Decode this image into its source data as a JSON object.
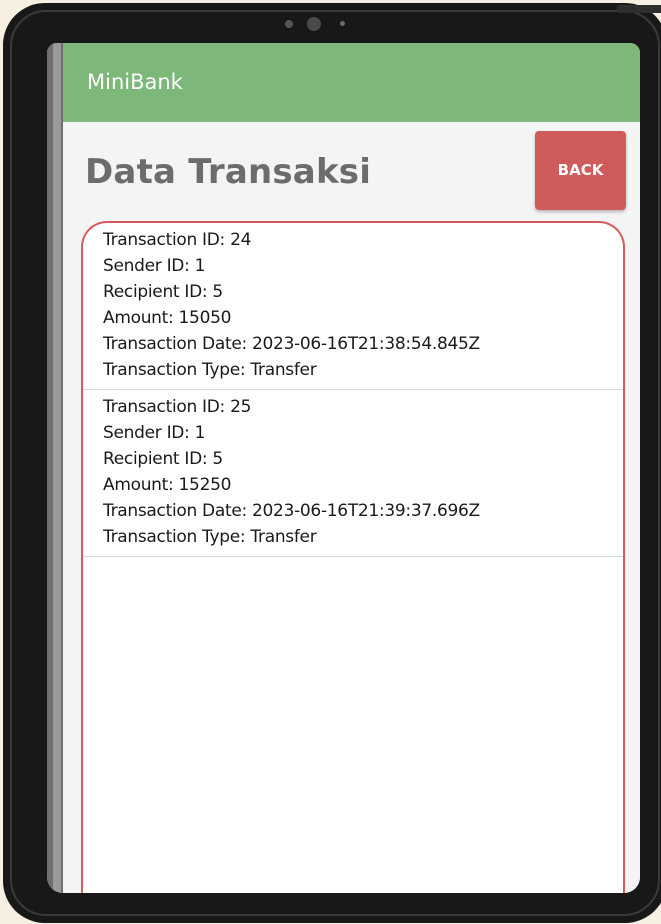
{
  "app": {
    "title": "MiniBank"
  },
  "page": {
    "title": "Data Transaksi",
    "back_label": "BACK"
  },
  "transactions": [
    {
      "id_line": "Transaction ID: 24",
      "sender_line": "Sender ID: 1",
      "recipient_line": "Recipient ID: 5",
      "amount_line": "Amount: 15050",
      "date_line": "Transaction Date: 2023-06-16T21:38:54.845Z",
      "type_line": "Transaction Type: Transfer"
    },
    {
      "id_line": "Transaction ID: 25",
      "sender_line": "Sender ID: 1",
      "recipient_line": "Recipient ID: 5",
      "amount_line": "Amount: 15250",
      "date_line": "Transaction Date: 2023-06-16T21:39:37.696Z",
      "type_line": "Transaction Type: Transfer"
    }
  ],
  "colors": {
    "app_bar": "#7db77a",
    "back_button": "#d05b5b",
    "list_border": "#d65c5c",
    "title_text": "#6c6c6c"
  }
}
